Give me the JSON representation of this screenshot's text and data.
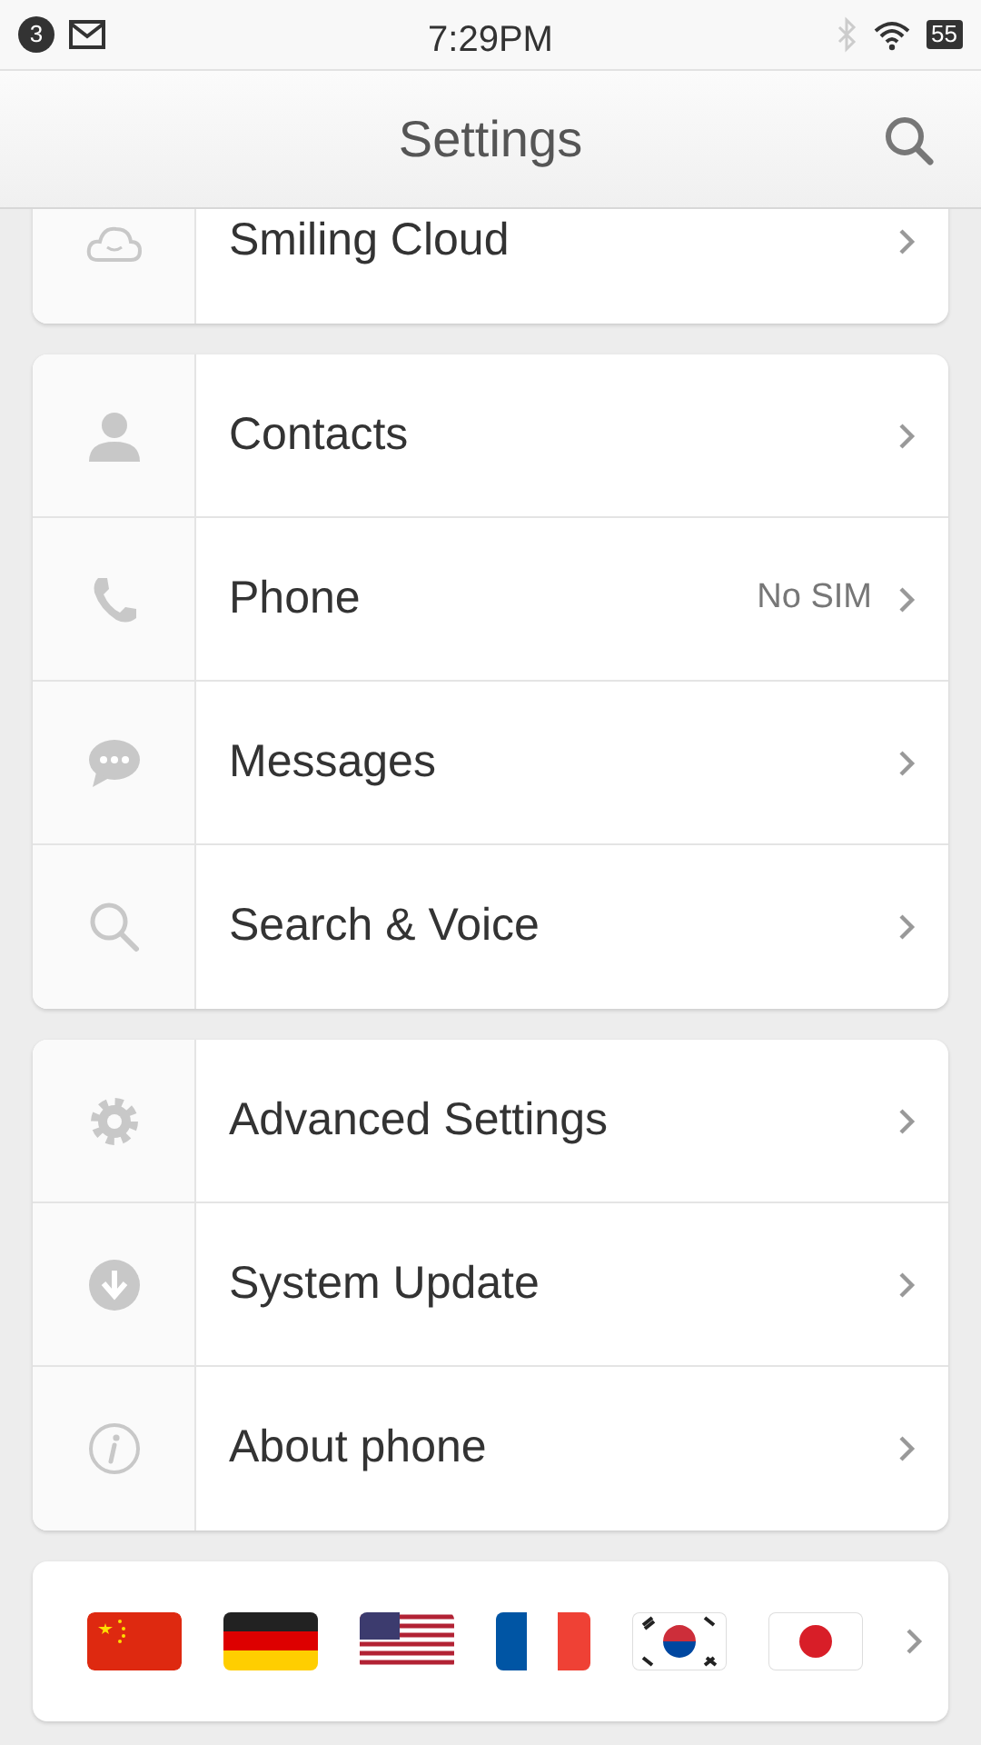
{
  "status_bar": {
    "notification_count": "3",
    "time": "7:29PM",
    "battery": "55"
  },
  "header": {
    "title": "Settings"
  },
  "sections": [
    {
      "items": [
        {
          "kind": "cloud",
          "label": "Smiling Cloud"
        }
      ]
    },
    {
      "items": [
        {
          "kind": "contacts",
          "label": "Contacts"
        },
        {
          "kind": "phone",
          "label": "Phone",
          "value": "No SIM"
        },
        {
          "kind": "messages",
          "label": "Messages"
        },
        {
          "kind": "search",
          "label": "Search & Voice"
        }
      ]
    },
    {
      "items": [
        {
          "kind": "gear",
          "label": "Advanced Settings"
        },
        {
          "kind": "update",
          "label": "System Update"
        },
        {
          "kind": "info",
          "label": "About phone"
        }
      ]
    }
  ],
  "languages": [
    {
      "kind": "cn"
    },
    {
      "kind": "de"
    },
    {
      "kind": "us"
    },
    {
      "kind": "fr"
    },
    {
      "kind": "kr"
    },
    {
      "kind": "jp"
    }
  ]
}
